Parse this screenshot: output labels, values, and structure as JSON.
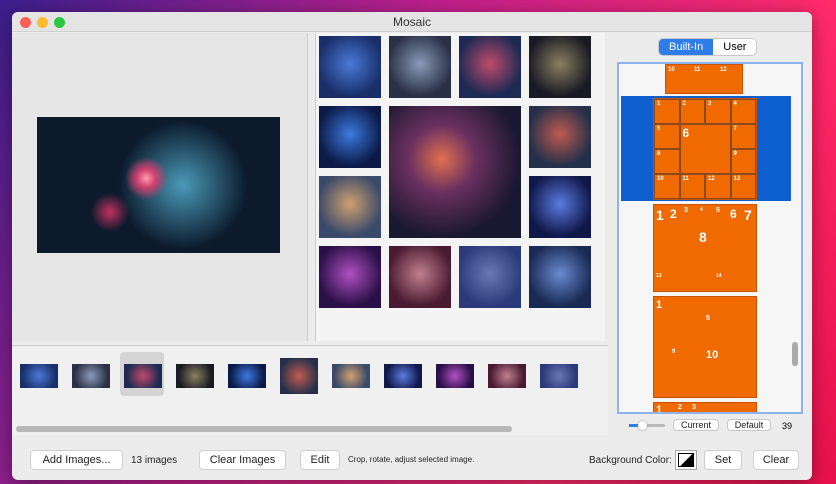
{
  "window": {
    "title": "Mosaic"
  },
  "tabs": [
    {
      "label": "Built-In",
      "active": true
    },
    {
      "label": "User",
      "active": false
    }
  ],
  "layouts": {
    "count_label": "39",
    "current_label": "Current",
    "default_label": "Default",
    "top_numbers": [
      "10",
      "11",
      "12"
    ],
    "selected_numbers": [
      "1",
      "2",
      "3",
      "4",
      "5",
      "6",
      "7",
      "8",
      "9",
      "10",
      "11",
      "12",
      "13"
    ],
    "third_numbers": [
      "1",
      "2",
      "3",
      "4",
      "5",
      "6",
      "7",
      "8",
      "13",
      "14"
    ],
    "fourth_numbers": [
      "1",
      "5",
      "9",
      "10"
    ],
    "fifth_numbers": [
      "1",
      "2",
      "3"
    ]
  },
  "toolbar": {
    "add_images": "Add Images...",
    "image_count": "13 images",
    "clear_images": "Clear Images",
    "edit": "Edit",
    "edit_hint": "Crop, rotate, adjust selected image.",
    "bg_color_label": "Background Color:",
    "set": "Set",
    "clear": "Clear"
  },
  "colors": {
    "accent": "#2f7de8",
    "layout": "#f06a00",
    "selection": "#0e5fd0"
  }
}
